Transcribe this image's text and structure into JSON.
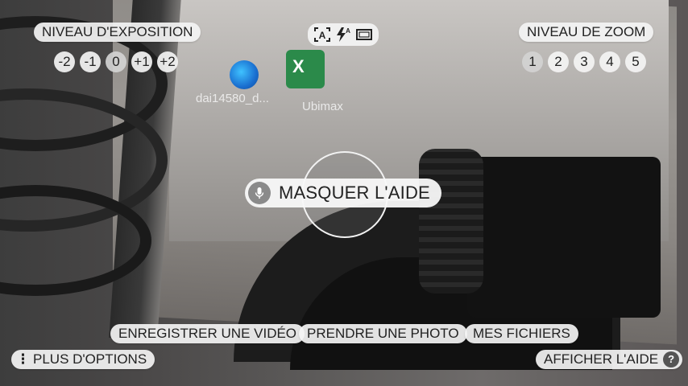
{
  "background": {
    "desktop_files": [
      {
        "label": "dai14580_d..."
      },
      {
        "label": "Ubimax"
      }
    ]
  },
  "exposure": {
    "title": "NIVEAU D'EXPOSITION",
    "levels": [
      "-2",
      "-1",
      "0",
      "+1",
      "+2"
    ],
    "selected": "0"
  },
  "zoom": {
    "title": "NIVEAU DE ZOOM",
    "levels": [
      "1",
      "2",
      "3",
      "4",
      "5"
    ],
    "selected": "1"
  },
  "camera_controls": {
    "icons": [
      "autofocus-icon",
      "flash-auto-icon",
      "aspect-ratio-icon"
    ]
  },
  "center": {
    "mask_help_label": "MASQUER L'AIDE",
    "mic_icon": "microphone-icon"
  },
  "bottom": {
    "record_video": "ENREGISTRER UNE VIDÉO",
    "take_photo": "PRENDRE UNE PHOTO",
    "my_files": "MES FICHIERS",
    "more_options": "PLUS D'OPTIONS",
    "show_help": "AFFICHER L'AIDE",
    "help_icon_glyph": "?"
  },
  "colors": {
    "pill_bg": "#f4f4f4",
    "text": "#222222",
    "mic_bg": "#8a8a8a"
  }
}
